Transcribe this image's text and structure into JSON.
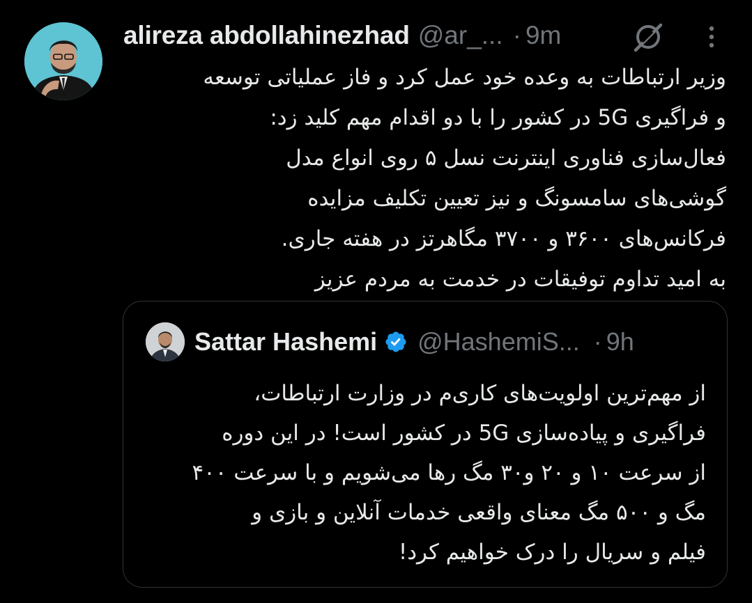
{
  "tweet": {
    "author": {
      "display_name": "alireza abdollahinezhad",
      "handle": "@ar_...",
      "avatar_icon": "user-avatar-photo"
    },
    "separator": "·",
    "time": "9m",
    "grok_icon": "grok-icon",
    "more_icon": "more-options-icon",
    "text_lines": [
      "وزیر ارتباطات به وعده خود عمل کرد و فاز عملیاتی توسعه",
      "و فراگیری 5G در کشور را با دو اقدام مهم کلید زد:",
      "فعال‌سازی فناوری اینترنت نسل ۵ روی انواع مدل",
      "گوشی‌های سامسونگ و نیز تعیین تکلیف مزایده",
      "فرکانس‌های ۳۶۰۰ و ۳۷۰۰ مگاهرتز در هفته جاری.",
      "به امید تداوم توفیقات در خدمت به مردم عزیز"
    ]
  },
  "quote": {
    "author": {
      "display_name": "Sattar Hashemi",
      "handle": "@HashemiS...",
      "verified": true,
      "verified_color": "#1d9bf0"
    },
    "separator": "·",
    "time": "9h",
    "text_lines": [
      "از مهم‌ترین اولویت‌های کاری‌م در وزارت ارتباطات،",
      "فراگیری و پیاده‌سازی 5G در کشور است! در این دوره",
      "از سرعت ۱۰ و ۲۰ و۳۰ مگ رها می‌شویم و با سرعت ۴۰۰",
      "مگ و ۵۰۰ مگ معنای واقعی خدمات آنلاین و بازی و",
      "فیلم و سریال را درک خواهیم کرد!"
    ]
  },
  "colors": {
    "background": "#000000",
    "text_primary": "#e7e9ea",
    "text_secondary": "#71767b",
    "border": "#2f3336",
    "verified": "#1d9bf0"
  }
}
